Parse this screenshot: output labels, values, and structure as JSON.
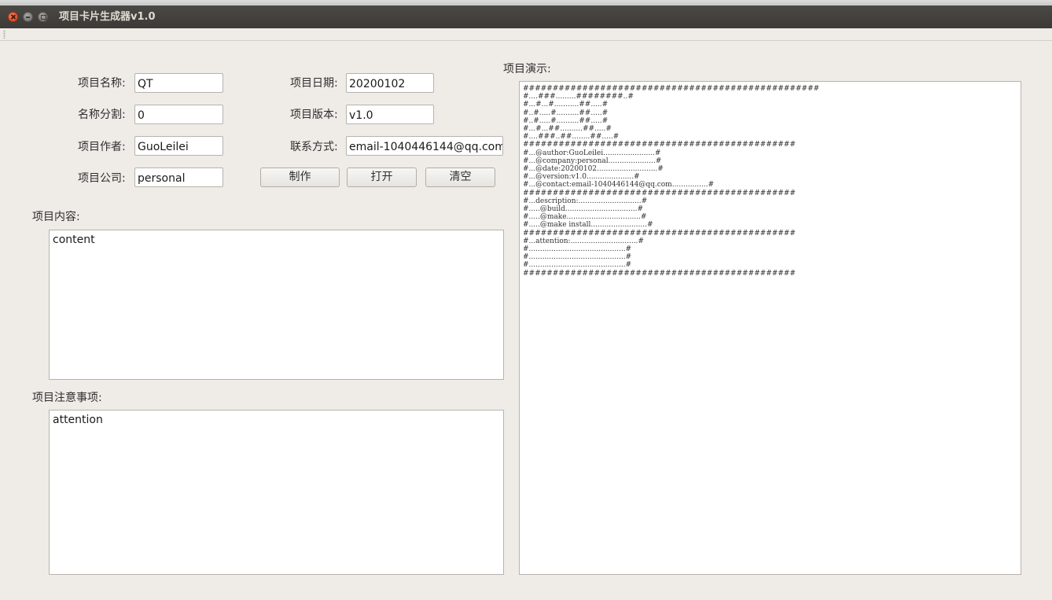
{
  "window": {
    "title": "项目卡片生成器v1.0"
  },
  "form": {
    "name_label": "项目名称:",
    "name_value": "QT",
    "split_label": "名称分割:",
    "split_value": "0",
    "author_label": "项目作者:",
    "author_value": "GuoLeilei",
    "company_label": "项目公司:",
    "company_value": "personal",
    "date_label": "项目日期:",
    "date_value": "20200102",
    "version_label": "项目版本:",
    "version_value": "v1.0",
    "contact_label": "联系方式:",
    "contact_value": "email-1040446144@qq.com"
  },
  "buttons": {
    "make": "制作",
    "open": "打开",
    "clear": "清空"
  },
  "content": {
    "label": "项目内容:",
    "value": "content"
  },
  "attention": {
    "label": "项目注意事项:",
    "value": "attention"
  },
  "preview": {
    "label": "项目演示:",
    "text": "##################################################\n#....###.........########..#\n#...#...#...........##.....#\n#..#.....#..........##.....#\n#..#.....#..........##.....#\n#...#...##..........##.....#\n#....###..##........##.....#\n##############################################\n#...@author:GuoLeilei.......................#\n#...@company:personal.....................#\n#...@date:20200102...........................#\n#...@version:v1.0.....................#\n#...@contact:email-1040446144@qq.com................#\n##############################################\n#...description:............................#\n#.....@build................................#\n#.....@make.................................#\n#.....@make install.........................#\n##############################################\n#...attention:..............................#\n#...........................................#\n#...........................................#\n#...........................................#\n##############################################"
  }
}
